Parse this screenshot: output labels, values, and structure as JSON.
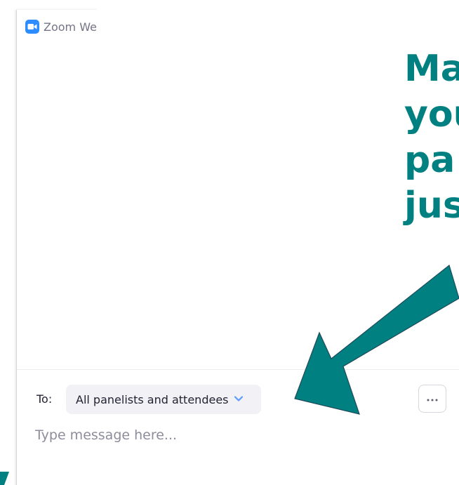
{
  "window": {
    "title": "Zoom Webinar Chat"
  },
  "headline": {
    "lines": [
      "Make sure",
      "your message is sent to",
      "panelists and attendees",
      "just not the panelists"
    ],
    "visible_lines": [
      "Ma",
      "you",
      "pa",
      "jus"
    ],
    "color": "#008080"
  },
  "chat": {
    "to_label": "To:",
    "recipient": "All panelists and attendees",
    "message_placeholder": "Type message here...",
    "more_icon": "more-horizontal-icon"
  },
  "colors": {
    "accent": "#008080",
    "zoom_blue": "#2d8cff",
    "chevron": "#5b9bff"
  }
}
